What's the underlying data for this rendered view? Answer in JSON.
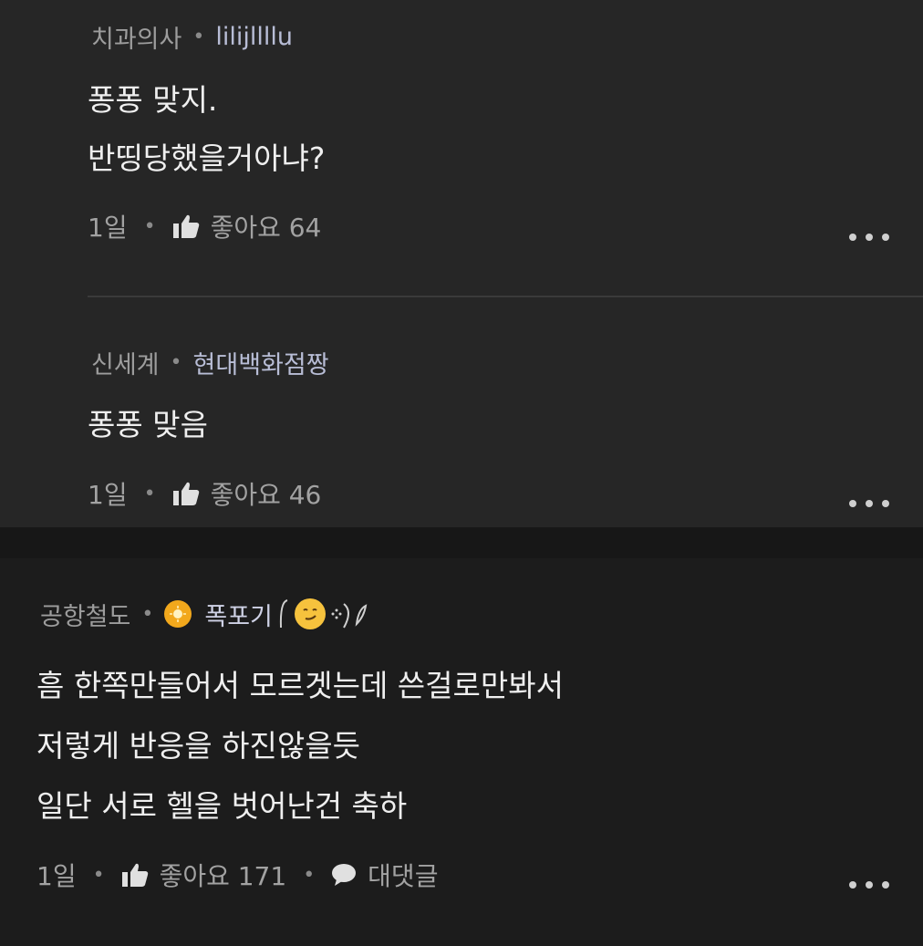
{
  "comments": [
    {
      "author": "치과의사",
      "mention": "lilijllllu",
      "lines": [
        "퐁퐁 맞지.",
        "반띵당했을거아냐?"
      ],
      "time": "1일",
      "likes_label": "좋아요 64"
    },
    {
      "author": "신세계",
      "mention": "현대백화점짱",
      "lines": [
        "퐁퐁 맞음"
      ],
      "time": "1일",
      "likes_label": "좋아요 46"
    },
    {
      "author": "공항철도",
      "user": "폭포기",
      "lines": [
        "흠 한쪽만들어서 모르겟는데 쓴걸로만봐서",
        "저렇게 반응을 하진않을듯",
        "일단 서로 헬을 벗어난건 축하"
      ],
      "time": "1일",
      "likes_label": "좋아요 171",
      "reply_label": "대댓글"
    }
  ],
  "icons": {
    "like": "thumbs-up-icon",
    "reply": "speech-bubble-icon",
    "more": "more-options-icon",
    "badge": "gold-badge-icon",
    "emoji": "smirk-emoji-icon"
  },
  "colors": {
    "reply_background": "#262626",
    "page_background": "#1c1c1c",
    "badge": "#f2a81c"
  }
}
